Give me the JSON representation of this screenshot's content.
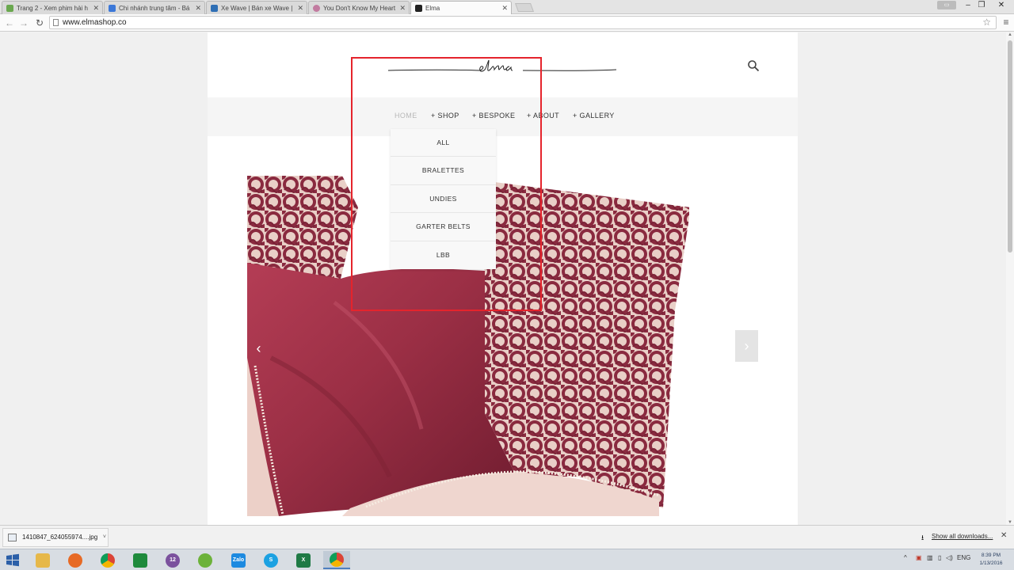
{
  "browser": {
    "tabs": [
      {
        "label": "Trang 2 - Xem phim hài h",
        "favicon_color": "#6aa84f"
      },
      {
        "label": "Chi nhánh trung tâm - Bá",
        "favicon_color": "#3c78d8"
      },
      {
        "label": "Xe Wave | Bán xe Wave | E",
        "favicon_color": "#2f6fb5"
      },
      {
        "label": "You Don't Know My Heart",
        "favicon_color": "#c27ba0"
      },
      {
        "label": "Elma",
        "favicon_color": "#222222"
      }
    ],
    "active_tab_index": 4,
    "url": "www.elmashop.co"
  },
  "site": {
    "brand": "elma",
    "nav": [
      {
        "label": "HOME",
        "dim": true
      },
      {
        "label": "+ SHOP",
        "dim": false
      },
      {
        "label": "+ BESPOKE",
        "dim": false
      },
      {
        "label": "+ ABOUT",
        "dim": false
      },
      {
        "label": "+ GALLERY",
        "dim": false
      }
    ],
    "shop_menu": [
      "ALL",
      "BRALETTES",
      "UNDIES",
      "GARTER BELTS",
      "LBB"
    ],
    "slider": {
      "prev_label": "‹",
      "next_label": "›"
    }
  },
  "downloads": {
    "item_name": "1410847_624055974....jpg",
    "show_all": "Show all downloads..."
  },
  "taskbar": {
    "language": "ENG",
    "time": "8:39 PM",
    "date": "1/13/2016",
    "viber_badge": "12",
    "zalo_label": "Zalo"
  },
  "colors": {
    "highlight": "#e5242c",
    "fabric_main": "#9b2f45",
    "lace": "#8a2a3f"
  }
}
